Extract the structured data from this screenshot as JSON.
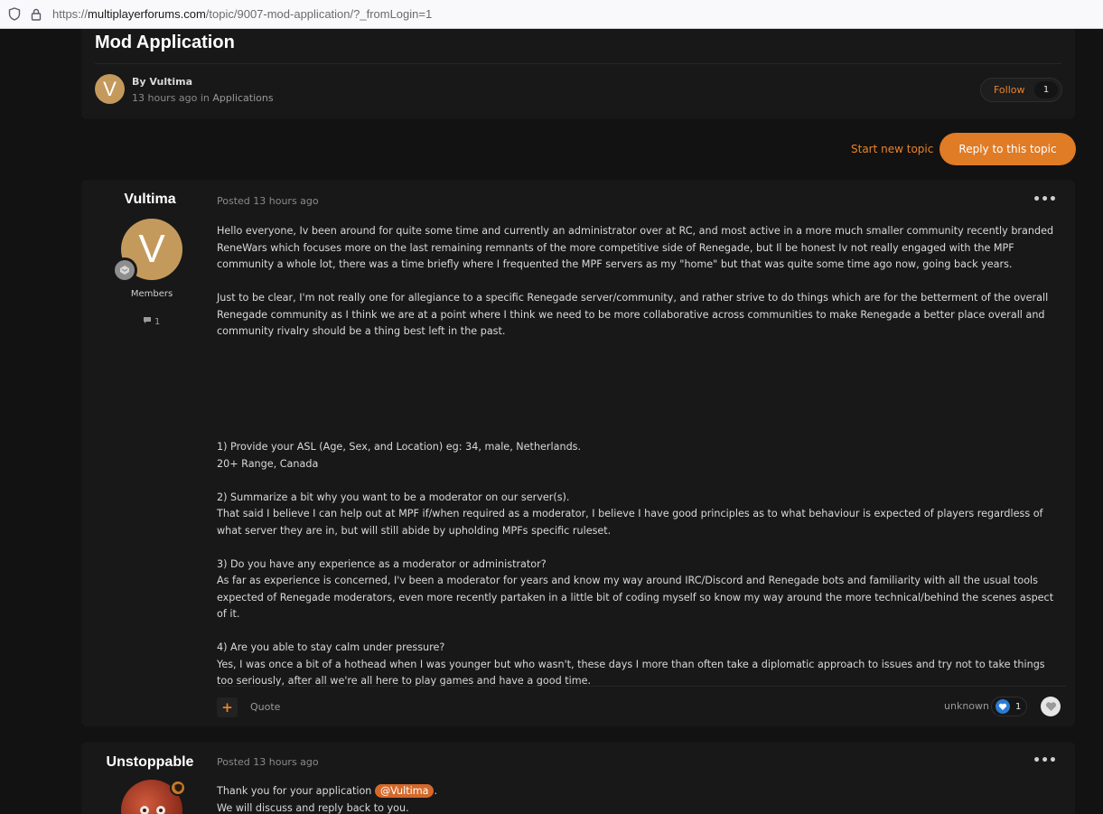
{
  "browser": {
    "url_prefix": "https://",
    "url_host": "multiplayerforums.com",
    "url_path": "/topic/9007-mod-application/?_fromLogin=1"
  },
  "topic": {
    "title": "Mod Application",
    "avatar_letter": "V",
    "by_label": "By Vultima",
    "time": "13 hours ago",
    "in_label": "in",
    "category": "Applications",
    "follow_label": "Follow",
    "follow_count": "1"
  },
  "actions": {
    "start_new_topic": "Start new topic",
    "reply": "Reply to this topic"
  },
  "post1": {
    "author": "Vultima",
    "avatar_letter": "V",
    "group": "Members",
    "post_count": "1",
    "posted": "Posted 13 hours ago",
    "menu": "•••",
    "paragraphs": [
      "Hello everyone, Iv been around for quite some time and currently an administrator over at RC, and most active in a more much smaller community recently branded ReneWars which focuses more on the last remaining remnants of the more competitive side of Renegade, but Il be honest Iv not really engaged with the MPF community a whole lot, there was a time briefly where I frequented the MPF servers as my \"home\" but that was quite some time ago now, going back years.",
      "Just to be clear, I'm not really one for allegiance to a specific Renegade server/community, and rather strive to do things which are for the betterment of the overall Renegade community as I think we are at a point where I think we need to be more collaborative across communities to make Renegade a better place overall and community rivalry should be a thing best left in the past.",
      "1) Provide your ASL (Age, Sex, and Location) eg: 34, male, Netherlands.",
      "20+ Range, Canada",
      "2) Summarize a bit why you want to be a moderator on our server(s).",
      "That said I believe I can help out at MPF if/when required as a moderator, I believe I have good principles as to what behaviour is expected of players regardless of what server they are in, but will still abide by upholding MPFs specific ruleset.",
      "3) Do you have any experience as a moderator or administrator?",
      "As far as experience is concerned, I'v been a moderator for years and know my way around IRC/Discord and Renegade bots and familiarity with all the usual tools expected of Renegade moderators, even more recently partaken in a little bit of coding myself so know my way around the more technical/behind the scenes aspect of it.",
      "4) Are you able to stay calm under pressure?",
      "Yes, I was once a bit of a hothead when I was younger but who wasn't, these days I more than often take a diplomatic approach to issues and try not to take things too seriously, after all we're all here to play games and have a good time."
    ],
    "plus": "+",
    "quote": "Quote",
    "reaction_user": "unknown",
    "reaction_count": "1"
  },
  "post2": {
    "author": "Unstoppable",
    "posted": "Posted 13 hours ago",
    "menu": "•••",
    "line1_prefix": "Thank you for your application ",
    "mention": "@Vultima",
    "line1_suffix": ".",
    "line2": "We will discuss and reply back to you."
  },
  "colors": {
    "accent": "#e07b26",
    "background": "#121212",
    "card": "#181818"
  },
  "icons": [
    "shield-icon",
    "lock-icon",
    "comment-icon",
    "heart-reaction-icon",
    "add-reaction-icon",
    "rank-badge-icon",
    "moderator-badge-icon"
  ]
}
